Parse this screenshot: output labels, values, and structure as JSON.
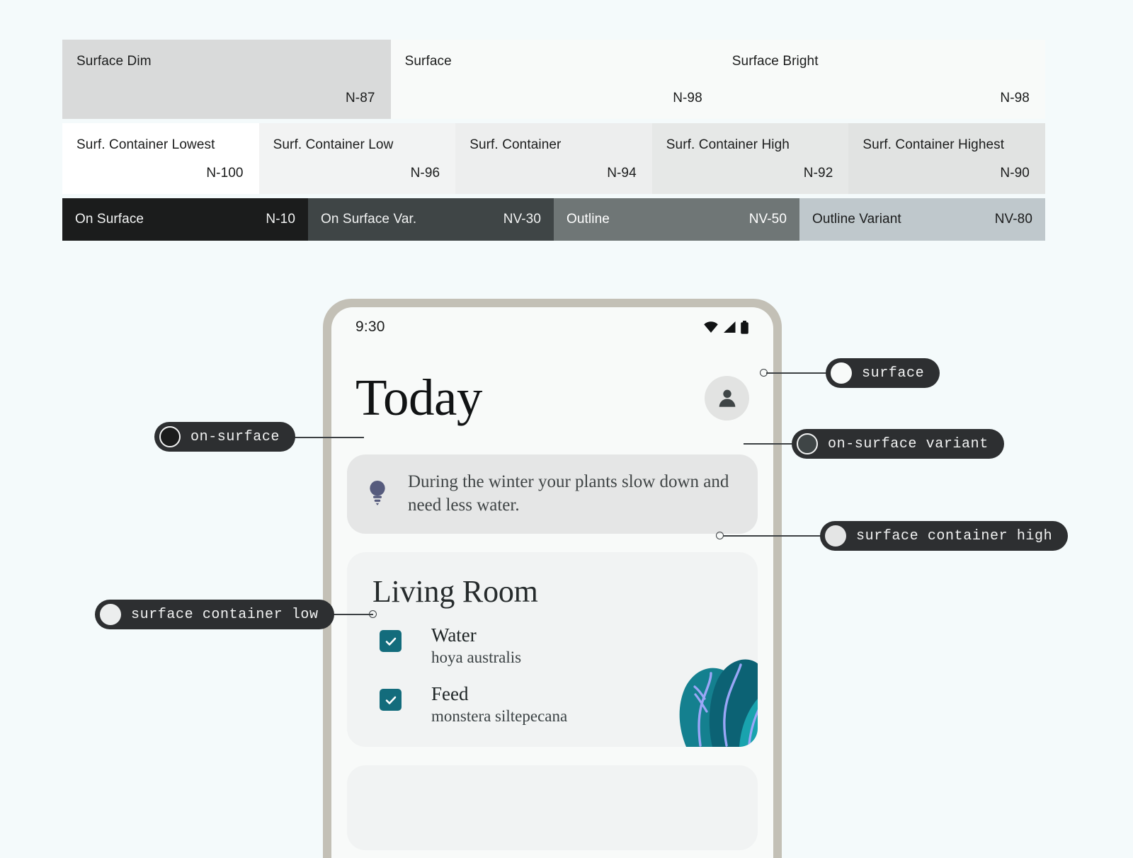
{
  "palette": {
    "page_background": "#f4fafb",
    "pill_background": "#2d2f31",
    "pill_text": "#f2f3f3",
    "leader_line": "#3c4043",
    "phone_bezel": "#c3c0b6",
    "checkbox_teal": "#136c7c",
    "tip_bulb": "#565b7d",
    "leaf_dark": "#0c6274",
    "leaf_mid": "#14808f",
    "leaf_light": "#19a3ae",
    "leaf_vein": "#9aa6f7"
  },
  "swatches": {
    "row_top": [
      {
        "name": "Surface Dim",
        "token": "N-87",
        "bg": "#d9dada",
        "fg": "#1b1c1c",
        "flex": 33.4
      },
      {
        "name": "Surface",
        "token": "N-98",
        "bg": "#f8faf9",
        "fg": "#1b1c1c",
        "flex": 33.3
      },
      {
        "name": "Surface Bright",
        "token": "N-98",
        "bg": "#f8faf9",
        "fg": "#1b1c1c",
        "flex": 33.3
      }
    ],
    "row_mid": [
      {
        "name": "Surf. Container Lowest",
        "token": "N-100",
        "bg": "#ffffff",
        "fg": "#1b1c1c",
        "flex": 20
      },
      {
        "name": "Surf. Container Low",
        "token": "N-96",
        "bg": "#f2f3f3",
        "fg": "#1b1c1c",
        "flex": 20
      },
      {
        "name": "Surf. Container",
        "token": "N-94",
        "bg": "#edeeee",
        "fg": "#1b1c1c",
        "flex": 20
      },
      {
        "name": "Surf. Container High",
        "token": "N-92",
        "bg": "#e6e8e7",
        "fg": "#1b1c1c",
        "flex": 20
      },
      {
        "name": "Surf. Container Highest",
        "token": "N-90",
        "bg": "#e1e3e2",
        "fg": "#1b1c1c",
        "flex": 20
      }
    ],
    "row_dark": [
      {
        "name": "On Surface",
        "token": "N-10",
        "bg": "#1b1c1c",
        "fg": "#f2f3f3",
        "flex": 25
      },
      {
        "name": "On Surface Var.",
        "token": "NV-30",
        "bg": "#3f4546",
        "fg": "#f2f3f3",
        "flex": 25
      },
      {
        "name": "Outline",
        "token": "NV-50",
        "bg": "#6f7676",
        "fg": "#ffffff",
        "flex": 25
      },
      {
        "name": "Outline Variant",
        "token": "NV-80",
        "bg": "#bfc8cc",
        "fg": "#1b1c1c",
        "flex": 25
      }
    ]
  },
  "phone": {
    "status_bar": {
      "time": "9:30",
      "icons": [
        "wifi-icon",
        "cell-signal-icon",
        "battery-icon"
      ]
    },
    "header": {
      "title": "Today",
      "avatar_icon": "person-icon"
    },
    "tip_card": {
      "icon": "lightbulb-icon",
      "text": "During the winter your plants slow down and need less water."
    },
    "room_card": {
      "title": "Living Room",
      "tasks": [
        {
          "title": "Water",
          "subtitle": "hoya australis",
          "checked": true
        },
        {
          "title": "Feed",
          "subtitle": "monstera siltepecana",
          "checked": true
        }
      ],
      "art": "plant-leaves-illustration"
    }
  },
  "annotations": [
    {
      "id": "surface",
      "label": "surface",
      "swatch": "#f8faf9",
      "swatch_border": "none"
    },
    {
      "id": "on-surface",
      "label": "on-surface",
      "swatch": "#1b1c1c",
      "swatch_border": "#f2f3f3"
    },
    {
      "id": "on-surface-variant",
      "label": "on-surface variant",
      "swatch": "#3f4546",
      "swatch_border": "#f2f3f3"
    },
    {
      "id": "surface-container-high",
      "label": "surface container high",
      "swatch": "#e4e5e5",
      "swatch_border": "none"
    },
    {
      "id": "surface-container-low",
      "label": "surface container low",
      "swatch": "#eceeee",
      "swatch_border": "none"
    }
  ]
}
